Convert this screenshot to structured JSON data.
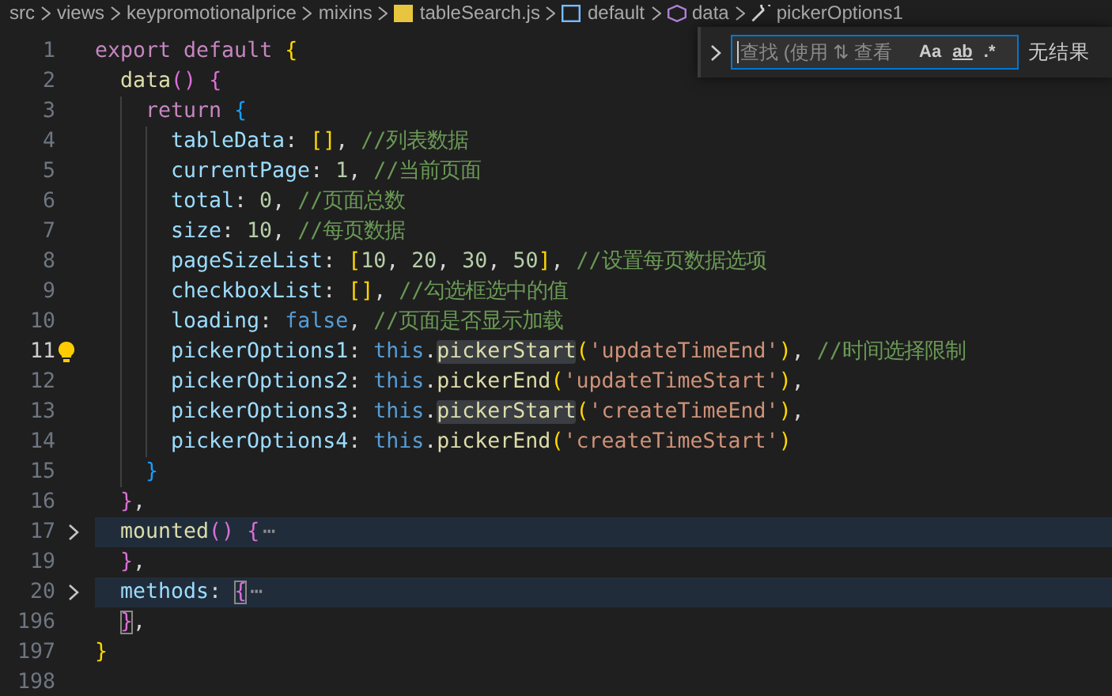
{
  "breadcrumb": [
    {
      "label": "src",
      "kind": "folder"
    },
    {
      "label": "views",
      "kind": "folder"
    },
    {
      "label": "keypromotionalprice",
      "kind": "folder"
    },
    {
      "label": "mixins",
      "kind": "folder"
    },
    {
      "label": "tableSearch.js",
      "kind": "js"
    },
    {
      "label": "default",
      "kind": "module"
    },
    {
      "label": "data",
      "kind": "method"
    },
    {
      "label": "pickerOptions1",
      "kind": "property"
    }
  ],
  "find_widget": {
    "expanded": false,
    "placeholder": "查找 (使用 ⇅ 查看",
    "toggles": [
      {
        "label": "Aa",
        "kind": "case",
        "selected": false
      },
      {
        "label": "ab",
        "kind": "word",
        "selected": false
      },
      {
        "label": ".*",
        "kind": "regex",
        "selected": false
      }
    ],
    "result": "无结果"
  },
  "lines": [
    {
      "number": "1",
      "current": false,
      "folded": false,
      "lightbulb": false,
      "tokens": [
        {
          "text": "export default ",
          "kind": "kw"
        },
        {
          "text": "{",
          "kind": "b1"
        }
      ],
      "children": [
        {
          "number": "2",
          "current": false,
          "folded": false,
          "lightbulb": false,
          "tokens": [
            {
              "text": "data",
              "kind": "fn"
            },
            {
              "text": "() ",
              "kind": "b2"
            },
            {
              "text": "{",
              "kind": "b2"
            }
          ],
          "children": [
            {
              "number": "3",
              "current": false,
              "folded": false,
              "lightbulb": false,
              "tokens": [
                {
                  "text": "return ",
                  "kind": "kw"
                },
                {
                  "text": "{",
                  "kind": "b3"
                }
              ],
              "children": [
                {
                  "number": "4",
                  "current": false,
                  "folded": false,
                  "lightbulb": false,
                  "tokens": [
                    {
                      "text": "tableData",
                      "kind": "prop"
                    },
                    {
                      "text": ": ",
                      "kind": "punct"
                    },
                    {
                      "text": "[]",
                      "kind": "b1"
                    },
                    {
                      "text": ", ",
                      "kind": "punct"
                    },
                    {
                      "text": "//列表数据",
                      "kind": "comment"
                    }
                  ]
                },
                {
                  "number": "5",
                  "current": false,
                  "folded": false,
                  "lightbulb": false,
                  "tokens": [
                    {
                      "text": "currentPage",
                      "kind": "prop"
                    },
                    {
                      "text": ": ",
                      "kind": "punct"
                    },
                    {
                      "text": "1",
                      "kind": "num"
                    },
                    {
                      "text": ", ",
                      "kind": "punct"
                    },
                    {
                      "text": "//当前页面",
                      "kind": "comment"
                    }
                  ]
                },
                {
                  "number": "6",
                  "current": false,
                  "folded": false,
                  "lightbulb": false,
                  "tokens": [
                    {
                      "text": "total",
                      "kind": "prop"
                    },
                    {
                      "text": ": ",
                      "kind": "punct"
                    },
                    {
                      "text": "0",
                      "kind": "num"
                    },
                    {
                      "text": ", ",
                      "kind": "punct"
                    },
                    {
                      "text": "//页面总数",
                      "kind": "comment"
                    }
                  ]
                },
                {
                  "number": "7",
                  "current": false,
                  "folded": false,
                  "lightbulb": false,
                  "tokens": [
                    {
                      "text": "size",
                      "kind": "prop"
                    },
                    {
                      "text": ": ",
                      "kind": "punct"
                    },
                    {
                      "text": "10",
                      "kind": "num"
                    },
                    {
                      "text": ", ",
                      "kind": "punct"
                    },
                    {
                      "text": "//每页数据",
                      "kind": "comment"
                    }
                  ]
                },
                {
                  "number": "8",
                  "current": false,
                  "folded": false,
                  "lightbulb": false,
                  "tokens": [
                    {
                      "text": "pageSizeList",
                      "kind": "prop"
                    },
                    {
                      "text": ": ",
                      "kind": "punct"
                    },
                    {
                      "text": "[",
                      "kind": "b1"
                    },
                    {
                      "text": "10",
                      "kind": "num"
                    },
                    {
                      "text": ", ",
                      "kind": "punct"
                    },
                    {
                      "text": "20",
                      "kind": "num"
                    },
                    {
                      "text": ", ",
                      "kind": "punct"
                    },
                    {
                      "text": "30",
                      "kind": "num"
                    },
                    {
                      "text": ", ",
                      "kind": "punct"
                    },
                    {
                      "text": "50",
                      "kind": "num"
                    },
                    {
                      "text": "]",
                      "kind": "b1"
                    },
                    {
                      "text": ", ",
                      "kind": "punct"
                    },
                    {
                      "text": "//设置每页数据选项",
                      "kind": "comment"
                    }
                  ]
                },
                {
                  "number": "9",
                  "current": false,
                  "folded": false,
                  "lightbulb": false,
                  "tokens": [
                    {
                      "text": "checkboxList",
                      "kind": "prop"
                    },
                    {
                      "text": ": ",
                      "kind": "punct"
                    },
                    {
                      "text": "[]",
                      "kind": "b1"
                    },
                    {
                      "text": ", ",
                      "kind": "punct"
                    },
                    {
                      "text": "//勾选框选中的值",
                      "kind": "comment"
                    }
                  ]
                },
                {
                  "number": "10",
                  "current": false,
                  "folded": false,
                  "lightbulb": false,
                  "tokens": [
                    {
                      "text": "loading",
                      "kind": "prop"
                    },
                    {
                      "text": ": ",
                      "kind": "punct"
                    },
                    {
                      "text": "false",
                      "kind": "this"
                    },
                    {
                      "text": ", ",
                      "kind": "punct"
                    },
                    {
                      "text": "//页面是否显示加载",
                      "kind": "comment"
                    }
                  ]
                },
                {
                  "number": "11",
                  "current": true,
                  "folded": false,
                  "lightbulb": true,
                  "tokens": [
                    {
                      "text": "pickerOptions1",
                      "kind": "prop"
                    },
                    {
                      "text": ": ",
                      "kind": "punct"
                    },
                    {
                      "text": "this",
                      "kind": "this"
                    },
                    {
                      "text": ".",
                      "kind": "punct"
                    },
                    {
                      "text": "pickerStart",
                      "kind": "fn-hl"
                    },
                    {
                      "text": "(",
                      "kind": "b1"
                    },
                    {
                      "text": "'updateTimeEnd'",
                      "kind": "str"
                    },
                    {
                      "text": ")",
                      "kind": "b1"
                    },
                    {
                      "text": ", ",
                      "kind": "punct"
                    },
                    {
                      "text": "//时间选择限制",
                      "kind": "comment"
                    }
                  ]
                },
                {
                  "number": "12",
                  "current": false,
                  "folded": false,
                  "lightbulb": false,
                  "tokens": [
                    {
                      "text": "pickerOptions2",
                      "kind": "prop"
                    },
                    {
                      "text": ": ",
                      "kind": "punct"
                    },
                    {
                      "text": "this",
                      "kind": "this"
                    },
                    {
                      "text": ".",
                      "kind": "punct"
                    },
                    {
                      "text": "pickerEnd",
                      "kind": "fn"
                    },
                    {
                      "text": "(",
                      "kind": "b1"
                    },
                    {
                      "text": "'updateTimeStart'",
                      "kind": "str"
                    },
                    {
                      "text": ")",
                      "kind": "b1"
                    },
                    {
                      "text": ",",
                      "kind": "punct"
                    }
                  ]
                },
                {
                  "number": "13",
                  "current": false,
                  "folded": false,
                  "lightbulb": false,
                  "tokens": [
                    {
                      "text": "pickerOptions3",
                      "kind": "prop"
                    },
                    {
                      "text": ": ",
                      "kind": "punct"
                    },
                    {
                      "text": "this",
                      "kind": "this"
                    },
                    {
                      "text": ".",
                      "kind": "punct"
                    },
                    {
                      "text": "pickerStart",
                      "kind": "fn-hl"
                    },
                    {
                      "text": "(",
                      "kind": "b1"
                    },
                    {
                      "text": "'createTimeEnd'",
                      "kind": "str"
                    },
                    {
                      "text": ")",
                      "kind": "b1"
                    },
                    {
                      "text": ",",
                      "kind": "punct"
                    }
                  ]
                },
                {
                  "number": "14",
                  "current": false,
                  "folded": false,
                  "lightbulb": false,
                  "tokens": [
                    {
                      "text": "pickerOptions4",
                      "kind": "prop"
                    },
                    {
                      "text": ": ",
                      "kind": "punct"
                    },
                    {
                      "text": "this",
                      "kind": "this"
                    },
                    {
                      "text": ".",
                      "kind": "punct"
                    },
                    {
                      "text": "pickerEnd",
                      "kind": "fn"
                    },
                    {
                      "text": "(",
                      "kind": "b1"
                    },
                    {
                      "text": "'createTimeStart'",
                      "kind": "str"
                    },
                    {
                      "text": ")",
                      "kind": "b1"
                    }
                  ]
                }
              ]
            },
            {
              "number": "15",
              "current": false,
              "folded": false,
              "lightbulb": false,
              "tokens": [
                {
                  "text": "}",
                  "kind": "b3"
                }
              ]
            }
          ]
        },
        {
          "number": "16",
          "current": false,
          "folded": false,
          "lightbulb": false,
          "tokens": [
            {
              "text": "}",
              "kind": "b2"
            },
            {
              "text": ",",
              "kind": "punct"
            }
          ]
        },
        {
          "number": "17",
          "current": false,
          "folded": true,
          "lightbulb": false,
          "tokens": [
            {
              "text": "mounted",
              "kind": "fn"
            },
            {
              "text": "() ",
              "kind": "b2"
            },
            {
              "text": "{",
              "kind": "b2"
            },
            {
              "text": "⋯",
              "kind": "fold"
            }
          ]
        },
        {
          "number": "19",
          "current": false,
          "folded": false,
          "lightbulb": false,
          "tokens": [
            {
              "text": "}",
              "kind": "b2"
            },
            {
              "text": ",",
              "kind": "punct"
            }
          ]
        },
        {
          "number": "20",
          "current": false,
          "folded": true,
          "lightbulb": false,
          "tokens": [
            {
              "text": "methods",
              "kind": "prop"
            },
            {
              "text": ": ",
              "kind": "punct"
            },
            {
              "text": "{",
              "kind": "b2-match"
            },
            {
              "text": "⋯",
              "kind": "fold"
            }
          ]
        },
        {
          "number": "196",
          "current": false,
          "folded": false,
          "lightbulb": false,
          "tokens": [
            {
              "text": "}",
              "kind": "b2-match"
            },
            {
              "text": ",",
              "kind": "punct"
            }
          ]
        }
      ]
    },
    {
      "number": "197",
      "current": false,
      "folded": false,
      "lightbulb": false,
      "tokens": [
        {
          "text": "}",
          "kind": "b1"
        }
      ]
    },
    {
      "number": "198",
      "current": false,
      "folded": false,
      "lightbulb": false
    }
  ]
}
